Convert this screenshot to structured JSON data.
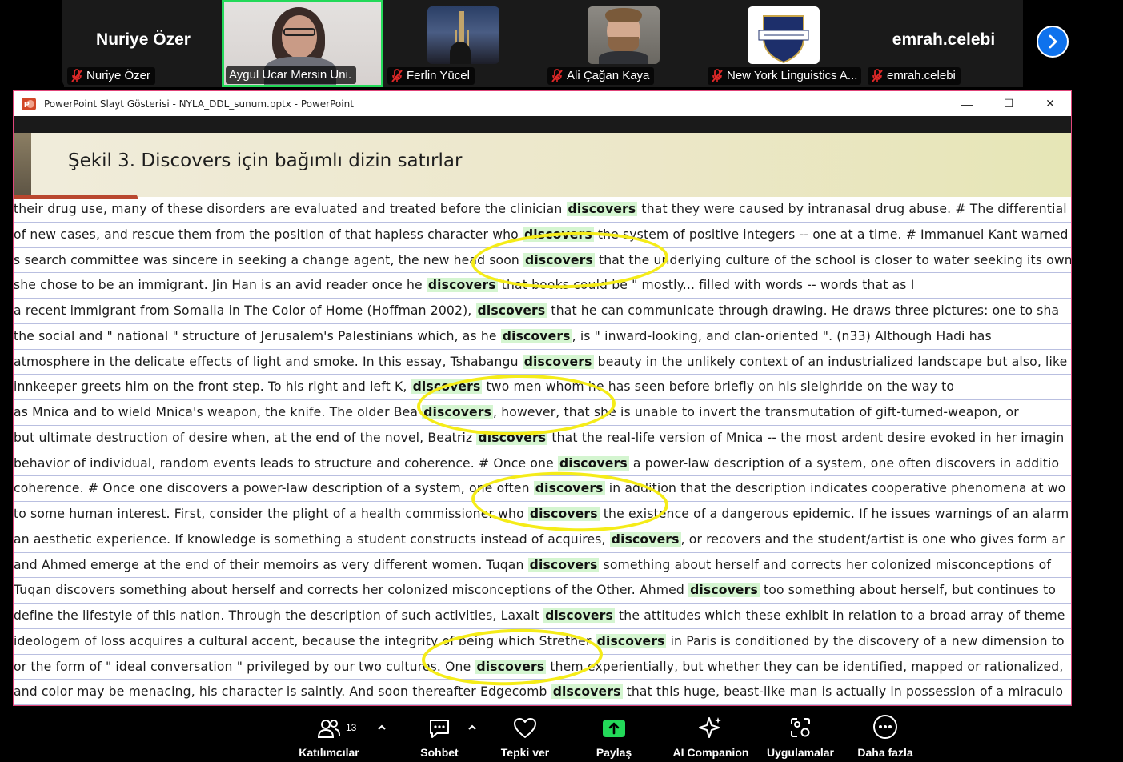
{
  "participants": [
    {
      "name": "Nuriye Özer",
      "big_name": "Nuriye Özer",
      "muted": true
    },
    {
      "name": "Aygul Ucar Mersin Uni.",
      "muted": false,
      "active": true
    },
    {
      "name": "Ferlin Yücel",
      "muted": true
    },
    {
      "name": "Ali Çağan Kaya",
      "muted": true
    },
    {
      "name": "New York Linguistics A...",
      "muted": true
    },
    {
      "name": "emrah.celebi",
      "big_name": "emrah.celebi",
      "muted": true
    }
  ],
  "window": {
    "title": "PowerPoint Slayt Gösterisi  -  NYLA_DDL_sunum.pptx - PowerPoint",
    "minimize": "—",
    "maximize": "☐",
    "close": "✕"
  },
  "slide": {
    "title": "Şekil 3. Discovers için bağımlı dizin satırlar",
    "lines": [
      {
        "pre": "their drug use, many of these disorders are evaluated and treated before the clinician ",
        "kw": "discovers",
        "post": " that they were caused by intranasal drug abuse. # The differential"
      },
      {
        "pre": "of new cases, and rescue them from the position of that hapless character who ",
        "kw": "discovers",
        "post": " the system of positive integers -- one at a time. # Immanuel Kant warned"
      },
      {
        "pre": "s search committee was sincere in seeking a change agent, the new head soon ",
        "kw": "discovers",
        "post": " that the underlying culture of the school is closer to water seeking its own"
      },
      {
        "pre": "she chose to be an immigrant. Jin Han is an avid reader once he ",
        "kw": "discovers",
        "post": " that books could be \" mostly... filled with words -- words that as I"
      },
      {
        "pre": "a recent immigrant from Somalia in The Color of Home (Hoffman 2002), ",
        "kw": "discovers",
        "post": " that he can communicate through drawing. He draws three pictures: one to sha"
      },
      {
        "pre": "the social and \" national \" structure of Jerusalem's Palestinians which, as he ",
        "kw": "discovers",
        "post": ", is \" inward-looking, and clan-oriented \". (n33) Although Hadi has"
      },
      {
        "pre": "atmosphere in the delicate effects of light and smoke. In this essay, Tshabangu ",
        "kw": "discovers",
        "post": " beauty in the unlikely context of an industrialized landscape but also, like"
      },
      {
        "pre": "innkeeper greets him on the front step. To his right and left K, ",
        "kw": "discovers",
        "post": " two men whom he has seen before briefly on his sleighride on the way to"
      },
      {
        "pre": "as Mnica and to wield Mnica's weapon, the knife. The older Bea ",
        "kw": "discovers",
        "post": ", however, that she is unable to invert the transmutation of gift-turned-weapon, or"
      },
      {
        "pre": "but ultimate destruction of desire when, at the end of the novel, Beatriz ",
        "kw": "discovers",
        "post": " that the real-life version of Mnica -- the most ardent desire evoked in her imagin"
      },
      {
        "pre": "behavior of individual, random events leads to structure and coherence. # Once one ",
        "kw": "discovers",
        "post": " a power-law description of a system, one often discovers in additio"
      },
      {
        "pre": "coherence. # Once one discovers a power-law description of a system, one often ",
        "kw": "discovers",
        "post": " in addition that the description indicates cooperative phenomena at wo"
      },
      {
        "pre": "to some human interest. First, consider the plight of a health commissioner who ",
        "kw": "discovers",
        "post": " the existence of a dangerous epidemic. If he issues warnings of an alarm"
      },
      {
        "pre": "an aesthetic experience. If knowledge is something a student constructs instead of acquires, ",
        "kw": "discovers",
        "post": ", or recovers and the student/artist is one who gives form ar"
      },
      {
        "pre": "and Ahmed emerge at the end of their memoirs as very different women. Tuqan ",
        "kw": "discovers",
        "post": " something about herself and corrects her colonized misconceptions of"
      },
      {
        "pre": "Tuqan discovers something about herself and corrects her colonized misconceptions of the Other. Ahmed ",
        "kw": "discovers",
        "post": " too something about herself, but continues to"
      },
      {
        "pre": "define the lifestyle of this nation. Through the description of such activities, Laxalt ",
        "kw": "discovers",
        "post": " the attitudes which these exhibit in relation to a broad array of theme"
      },
      {
        "pre": "ideologem of loss acquires a cultural accent, because the integrity of being which Strether ",
        "kw": "discovers",
        "post": " in Paris is conditioned by the discovery of a new dimension to"
      },
      {
        "pre": "or the form of \" ideal conversation \" privileged by our two cultures. One ",
        "kw": "discovers",
        "post": " them experientially, but whether they can be identified, mapped or rationalized,"
      },
      {
        "pre": "and color may be menacing, his character is saintly. And soon thereafter Edgecomb ",
        "kw": "discovers",
        "post": " that this huge, beast-like man is actually in possession of a miraculo"
      }
    ]
  },
  "toolbar": {
    "participants_label": "Katılımcılar",
    "participants_count": "13",
    "chat_label": "Sohbet",
    "react_label": "Tepki ver",
    "share_label": "Paylaş",
    "ai_label": "AI Companion",
    "apps_label": "Uygulamalar",
    "more_label": "Daha fazla"
  },
  "colors": {
    "share_green": "#23d959",
    "active_speaker_border": "#23d959",
    "highlight_keyword": "#d4f5d0",
    "annotation_yellow": "#f5ec18",
    "next_button_blue": "#0e72ed"
  }
}
